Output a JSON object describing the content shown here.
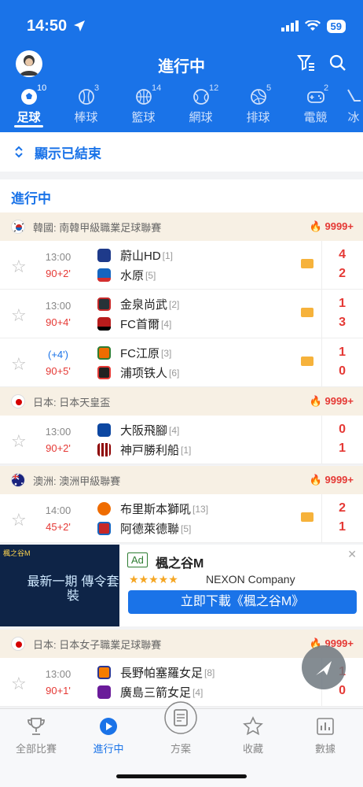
{
  "status": {
    "time": "14:50",
    "battery": "59"
  },
  "header": {
    "title": "進行中"
  },
  "tabs": [
    {
      "label": "足球",
      "count": "10",
      "active": true
    },
    {
      "label": "棒球",
      "count": "3"
    },
    {
      "label": "籃球",
      "count": "14"
    },
    {
      "label": "網球",
      "count": "12"
    },
    {
      "label": "排球",
      "count": "5"
    },
    {
      "label": "電競",
      "count": "2"
    },
    {
      "label": "冰"
    }
  ],
  "show_finished": "顯示已結束",
  "section_title": "進行中",
  "leagues": [
    {
      "name": "韓國: 南韓甲級職業足球聯賽",
      "heat": "9999+"
    },
    {
      "name": "日本: 日本天皇盃",
      "heat": "9999+"
    },
    {
      "name": "澳洲: 澳洲甲級聯賽",
      "heat": "9999+"
    },
    {
      "name": "日本: 日本女子職業足球聯賽",
      "heat": "9999+"
    }
  ],
  "matches": [
    {
      "time": "13:00",
      "minute": "90+2'",
      "home": "蔚山HD",
      "home_rank": "[1]",
      "away": "水原",
      "away_rank": "[5]",
      "home_score": "4",
      "away_score": "2"
    },
    {
      "time": "13:00",
      "minute": "90+4'",
      "home": "金泉尚武",
      "home_rank": "[2]",
      "away": "FC首爾",
      "away_rank": "[4]",
      "home_score": "1",
      "away_score": "3"
    },
    {
      "time": "(+4')",
      "minute": "90+5'",
      "home": "FC江原",
      "home_rank": "[3]",
      "away": "浦项铁人",
      "away_rank": "[6]",
      "home_score": "1",
      "away_score": "0"
    },
    {
      "time": "13:00",
      "minute": "90+2'",
      "home": "大阪飛腳",
      "home_rank": "[4]",
      "away": "神戸勝利船",
      "away_rank": "[1]",
      "home_score": "0",
      "away_score": "1"
    },
    {
      "time": "14:00",
      "minute": "45+2'",
      "home": "布里斯本獅吼",
      "home_rank": "[13]",
      "away": "阿德萊德聯",
      "away_rank": "[5]",
      "home_score": "2",
      "away_score": "1"
    },
    {
      "time": "13:00",
      "minute": "90+1'",
      "home": "長野帕塞羅女足",
      "home_rank": "[8]",
      "away": "廣島三箭女足",
      "away_rank": "[4]",
      "home_score": "1",
      "away_score": "0"
    }
  ],
  "ad": {
    "tag": "Ad",
    "title": "楓之谷M",
    "stars": "★★★★★",
    "company": "NEXON Company",
    "button": "立即下載《楓之谷M》",
    "image_text": "最新一期 傳令套裝",
    "logo": "楓之谷M"
  },
  "nav": [
    {
      "label": "全部比賽"
    },
    {
      "label": "進行中",
      "active": true
    },
    {
      "label": "方案"
    },
    {
      "label": "收藏"
    },
    {
      "label": "數據"
    }
  ],
  "colors": {
    "primary": "#1a73e8",
    "score": "#e53935",
    "heat": "#e53935"
  }
}
